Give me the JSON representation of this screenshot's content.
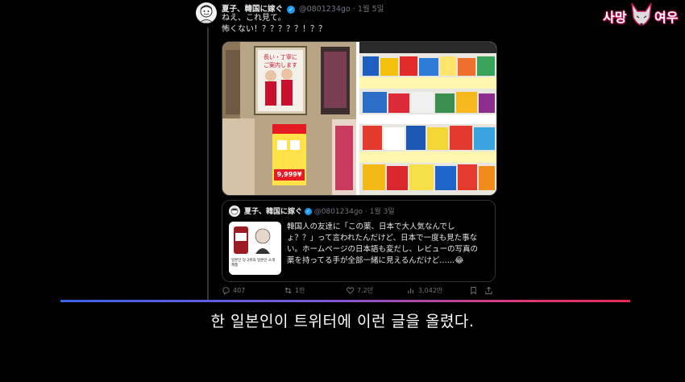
{
  "tweet": {
    "display_name": "夏子、韓国に嫁ぐ",
    "handle": "@0801234go",
    "date": "1월 5일",
    "line1": "ねえ、これ見て。",
    "line2": "怖くない！？？？？？！？？"
  },
  "photo_left": {
    "sign_line1": "長い・丁寧に",
    "sign_line2": "ご案内します",
    "price": "9,999¥"
  },
  "quote": {
    "display_name": "夏子、韓国に嫁ぐ",
    "handle": "@0801234go",
    "date": "1월 3일",
    "text": "韓国人の友達に「この薬、日本で大人気なんでし\nょ？？」って言われたんだけど、日本で一度も見た事な\nい。ホームページの日本語も変だし、レビューの写真の\n薬を持ってる手が全部一緒に見えるんだけど……😂",
    "thumb_caption": "일본인 당 2위의 일본인 소개 제품"
  },
  "actions": {
    "replies": "407",
    "reposts": "1만",
    "likes": "7.2만",
    "views": "3,042만"
  },
  "subtitle": "한 일본인이 트위터에 이런 글을 올렸다.",
  "logo": {
    "left": "사망",
    "right": "여우"
  },
  "colors": {
    "verified": "#1d9bf0",
    "gradient_start": "#3b63e8",
    "gradient_end": "#e62a55",
    "logo_glow": "#e0115f"
  }
}
